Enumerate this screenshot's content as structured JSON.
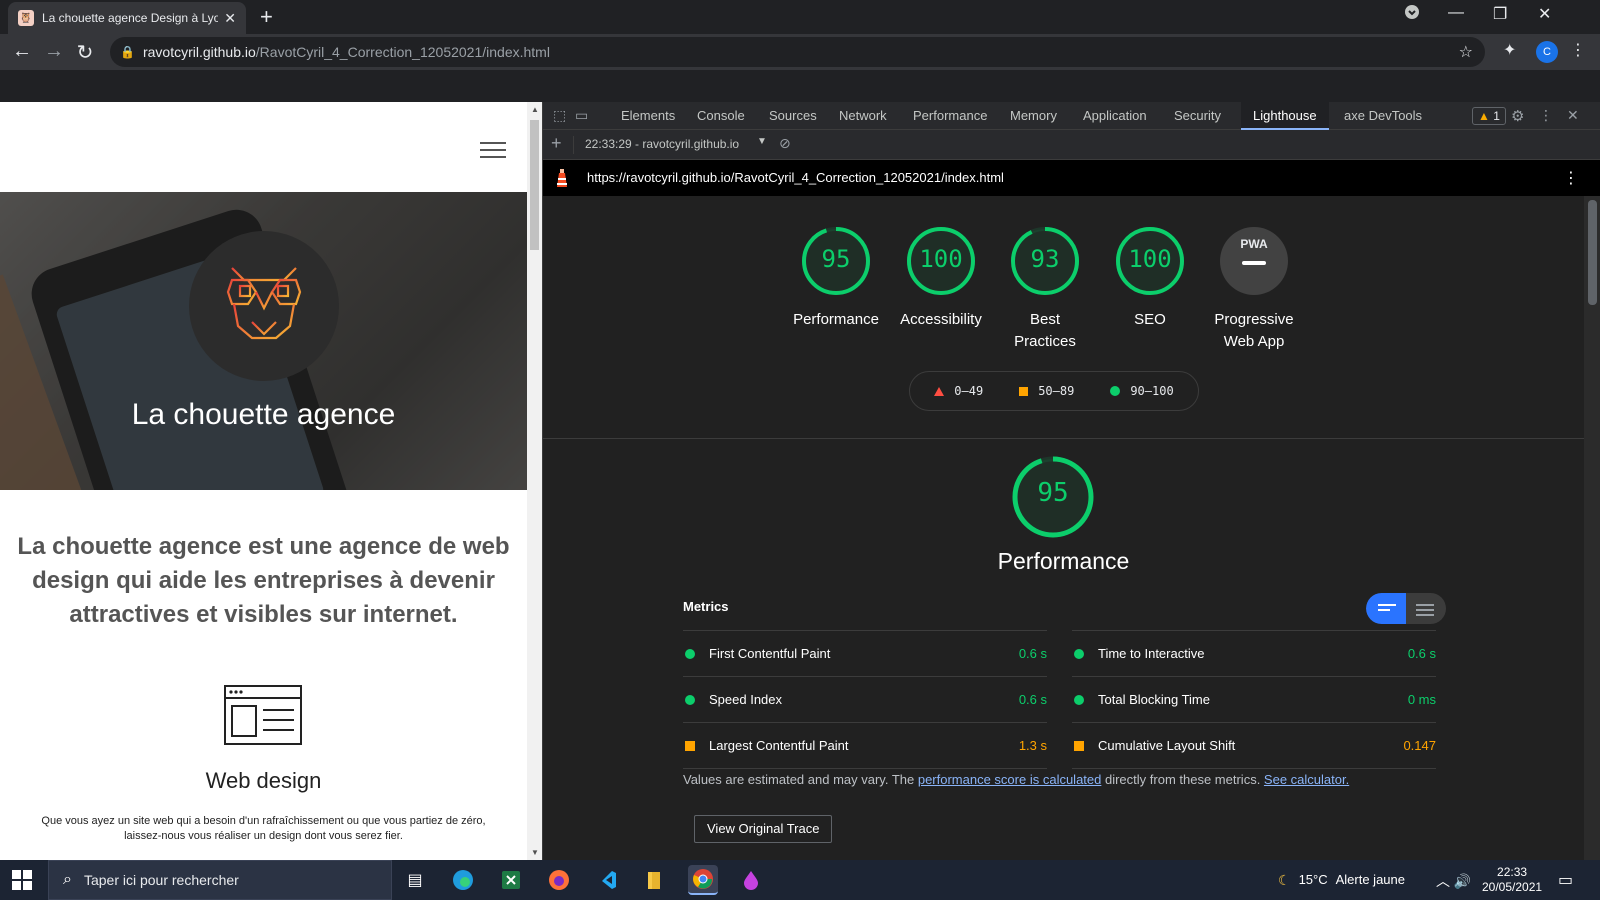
{
  "tab": {
    "title": "La chouette agence Design à Lyo",
    "close": "✕",
    "new": "+"
  },
  "window": {
    "minimize": "—",
    "restore": "❐",
    "close": "✕"
  },
  "omnibox": {
    "host": "ravotcyril.github.io",
    "path": "/RavotCyril_4_Correction_12052021/index.html"
  },
  "profile_initial": "C",
  "page": {
    "hero_title": "La chouette agence",
    "lead": "La chouette agence est une agence de web design qui aide les entreprises à devenir attractives et visibles sur internet.",
    "service_title": "Web design",
    "service_desc": "Que vous ayez un site web qui a besoin d'un rafraîchissement ou que vous partiez de zéro, laissez-nous vous réaliser un design dont vous serez fier."
  },
  "devtools": {
    "tabs": [
      "Elements",
      "Console",
      "Sources",
      "Network",
      "Performance",
      "Memory",
      "Application",
      "Security",
      "Lighthouse",
      "axe DevTools"
    ],
    "active_tab": "Lighthouse",
    "warning_count": "1",
    "report_label": "22:33:29 - ravotcyril.github.io",
    "report_url": "https://ravotcyril.github.io/RavotCyril_4_Correction_12052021/index.html"
  },
  "lighthouse": {
    "scores": [
      {
        "label": "Performance",
        "value": "95",
        "score": 95
      },
      {
        "label": "Accessibility",
        "value": "100",
        "score": 100
      },
      {
        "label": "Best Practices",
        "value": "93",
        "score": 93
      },
      {
        "label": "SEO",
        "value": "100",
        "score": 100
      },
      {
        "label": "Progressive Web App",
        "value": "PWA",
        "score": null
      }
    ],
    "legend": {
      "fail": "0–49",
      "average": "50–89",
      "pass": "90–100"
    },
    "section_score": "95",
    "section_title": "Performance",
    "metrics_header": "Metrics",
    "metrics_left": [
      {
        "name": "First Contentful Paint",
        "value": "0.6 s",
        "rating": "pass"
      },
      {
        "name": "Speed Index",
        "value": "0.6 s",
        "rating": "pass"
      },
      {
        "name": "Largest Contentful Paint",
        "value": "1.3 s",
        "rating": "average"
      }
    ],
    "metrics_right": [
      {
        "name": "Time to Interactive",
        "value": "0.6 s",
        "rating": "pass"
      },
      {
        "name": "Total Blocking Time",
        "value": "0 ms",
        "rating": "pass"
      },
      {
        "name": "Cumulative Layout Shift",
        "value": "0.147",
        "rating": "average"
      }
    ],
    "note_prefix": "Values are estimated and may vary. The ",
    "note_link1": "performance score is calculated",
    "note_middle": " directly from these metrics. ",
    "note_link2": "See calculator.",
    "trace_button": "View Original Trace"
  },
  "colors": {
    "pass": "#0cce6b",
    "average": "#ffa400",
    "fail": "#ff4e42",
    "accent": "#2a74ff"
  },
  "taskbar": {
    "search_placeholder": "Taper ici pour rechercher",
    "weather_temp": "15°C",
    "weather_alert": "Alerte jaune",
    "time": "22:33",
    "date": "20/05/2021"
  }
}
